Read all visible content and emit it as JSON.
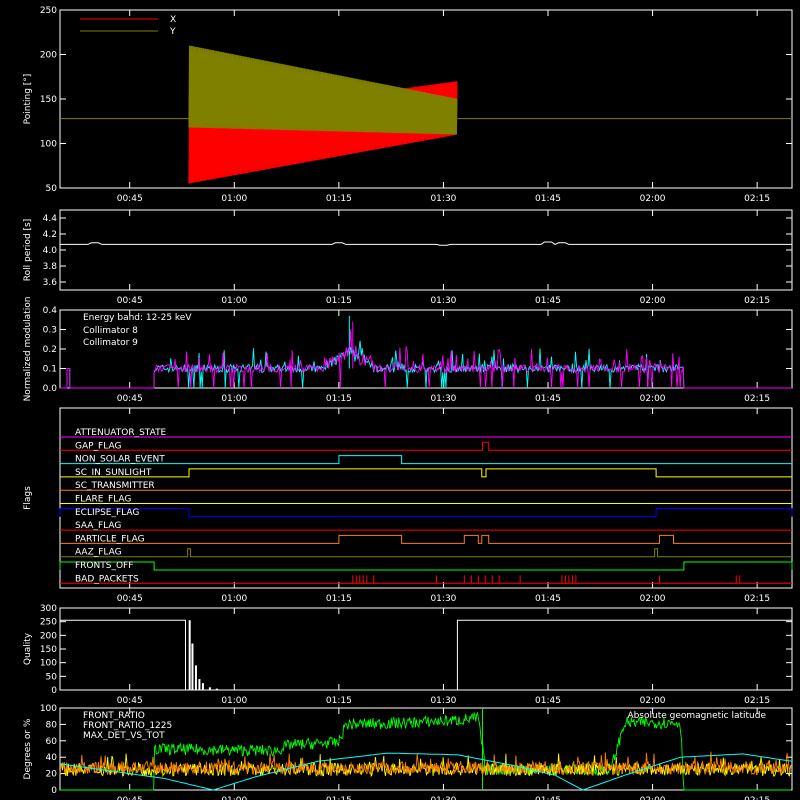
{
  "x_axis": {
    "ticks": [
      "00:45",
      "01:00",
      "01:15",
      "01:30",
      "01:45",
      "02:00",
      "02:15"
    ],
    "tick_minutes": [
      45,
      60,
      75,
      90,
      105,
      120,
      135
    ],
    "range_minutes": [
      35,
      140
    ]
  },
  "chart_data": [
    {
      "type": "line",
      "ylabel": "Pointing [°]",
      "ylim": [
        50,
        250
      ],
      "yticks": [
        "50",
        "100",
        "150",
        "200",
        "250"
      ],
      "ytick_values": [
        50,
        100,
        150,
        200,
        250
      ],
      "legend": [
        {
          "name": "X",
          "color": "#ff0000"
        },
        {
          "name": "Y",
          "color": "#808000"
        }
      ],
      "baseline": 128,
      "series": [
        {
          "name": "X",
          "color": "#ff0000",
          "segments": [
            {
              "t0": 35,
              "t1": 53.5,
              "value": 128
            },
            {
              "t0": 53.5,
              "t1": 92,
              "osc_low": [
                55,
                110
              ],
              "osc_high": [
                130,
                170
              ]
            },
            {
              "t0": 92,
              "t1": 140,
              "value": 128
            }
          ]
        },
        {
          "name": "Y",
          "color": "#808000",
          "segments": [
            {
              "t0": 53.5,
              "t1": 92,
              "osc_low": [
                118,
                110
              ],
              "osc_high": [
                210,
                150
              ]
            }
          ]
        }
      ]
    },
    {
      "type": "line",
      "ylabel": "Roll period [s]",
      "ylim": [
        3.5,
        4.5
      ],
      "yticks": [
        "3.6",
        "3.8",
        "4.0",
        "4.2",
        "4.4"
      ],
      "ytick_values": [
        3.6,
        3.8,
        4.0,
        4.2,
        4.4
      ],
      "series": [
        {
          "name": "",
          "color": "#ffffff",
          "value": 4.07,
          "bumps": [
            [
              40,
              4.09
            ],
            [
              75,
              4.09
            ],
            [
              90,
              4.06
            ],
            [
              105,
              4.1
            ],
            [
              107,
              4.09
            ]
          ]
        }
      ]
    },
    {
      "type": "line",
      "ylabel": "Normalized modulation",
      "ylim": [
        0,
        0.4
      ],
      "yticks": [
        "0.0",
        "0.1",
        "0.2",
        "0.3",
        "0.4"
      ],
      "ytick_values": [
        0,
        0.1,
        0.2,
        0.3,
        0.4
      ],
      "annotation": "Energy band: 12-25 keV",
      "legend": [
        {
          "name": "Collimator 8",
          "color": "#00ffff"
        },
        {
          "name": "Collimator 9",
          "color": "#ff00ff"
        }
      ],
      "active_range": [
        48.5,
        124.5
      ],
      "series": [
        {
          "name": "Collimator 8",
          "color": "#00ffff",
          "level": 0.1,
          "peak": 0.37
        },
        {
          "name": "Collimator 9",
          "color": "#ff00ff",
          "level": 0.1,
          "peak": 0.34
        }
      ]
    },
    {
      "type": "line",
      "ylabel": "Flags",
      "flags": [
        {
          "label": "ATTENUATOR_STATE",
          "color": "#ff00ff",
          "high": []
        },
        {
          "label": "GAP_FLAG",
          "color": "#ff0000",
          "high": [
            [
              95.6,
              96.5
            ]
          ]
        },
        {
          "label": "NON_SOLAR_EVENT",
          "color": "#00ffff",
          "high": [
            [
              75,
              84
            ]
          ]
        },
        {
          "label": "SC_IN_SUNLIGHT",
          "color": "#ffff00",
          "high": [
            [
              53.5,
              95.5
            ],
            [
              96.1,
              120.5
            ]
          ]
        },
        {
          "label": "SC_TRANSMITTER",
          "color": "#ff8000",
          "high": []
        },
        {
          "label": "FLARE_FLAG",
          "color": "#ffff00",
          "high": []
        },
        {
          "label": "ECLIPSE_FLAG",
          "color": "#0000ff",
          "high": [
            [
              35,
              53.5
            ],
            [
              120.5,
              140
            ]
          ]
        },
        {
          "label": "SAA_FLAG",
          "color": "#ff0000",
          "high": []
        },
        {
          "label": "PARTICLE_FLAG",
          "color": "#ff8000",
          "high": [
            [
              75,
              84
            ],
            [
              93,
              95
            ],
            [
              95.5,
              96.5
            ],
            [
              121,
              123
            ]
          ]
        },
        {
          "label": "AAZ_FLAG",
          "color": "#808000",
          "high": [
            [
              53.3,
              53.7
            ],
            [
              120.3,
              120.7
            ]
          ]
        },
        {
          "label": "FRONTS_OFF",
          "color": "#00ff00",
          "high": [
            [
              35,
              48.5
            ],
            [
              124.5,
              140
            ]
          ]
        },
        {
          "label": "BAD_PACKETS",
          "color": "#ff0000",
          "spikes": [
            77,
            77.5,
            78,
            78.5,
            79,
            80,
            89,
            93,
            94,
            95,
            96,
            97,
            98,
            101,
            107,
            107.5,
            108,
            108.5,
            109,
            121,
            132,
            132.5
          ]
        }
      ]
    },
    {
      "type": "line",
      "ylabel": "Quality",
      "ylim": [
        0,
        300
      ],
      "yticks": [
        "0",
        "50",
        "100",
        "150",
        "200",
        "250",
        "300"
      ],
      "ytick_values": [
        0,
        50,
        100,
        150,
        200,
        250,
        300
      ],
      "series": [
        {
          "name": "",
          "color": "#ffffff",
          "segments": [
            [
              35,
              53,
              255
            ],
            [
              53.5,
              92,
              0
            ],
            [
              92,
              140,
              255
            ]
          ],
          "spikes": [
            [
              53.6,
              255
            ],
            [
              54,
              170
            ],
            [
              54.5,
              90
            ],
            [
              55,
              40
            ],
            [
              55.5,
              25
            ],
            [
              56.5,
              10
            ],
            [
              57.5,
              5
            ]
          ]
        }
      ]
    },
    {
      "type": "line",
      "ylabel": "Degrees or %",
      "ylim": [
        0,
        100
      ],
      "yticks": [
        "0",
        "20",
        "40",
        "60",
        "80",
        "100"
      ],
      "ytick_values": [
        0,
        20,
        40,
        60,
        80,
        100
      ],
      "legend": [
        {
          "name": "FRONT_RATIO",
          "color": "#ffff00"
        },
        {
          "name": "FRONT_RATIO_1225",
          "color": "#00ff00"
        },
        {
          "name": "MAX_DET_VS_TOT",
          "color": "#ff8000"
        }
      ],
      "right_label": {
        "text": "Absolute geomagnetic latitude",
        "color": "#00ffff"
      },
      "series": [
        {
          "name": "FRONT_RATIO",
          "color": "#ffff00",
          "level": 25
        },
        {
          "name": "FRONT_RATIO_1225",
          "color": "#00ff00",
          "profile": [
            [
              35,
              0
            ],
            [
              48.5,
              0
            ],
            [
              48.5,
              50
            ],
            [
              66,
              48
            ],
            [
              68,
              55
            ],
            [
              75,
              58
            ],
            [
              76,
              80
            ],
            [
              85,
              82
            ],
            [
              92,
              85
            ],
            [
              95,
              88
            ],
            [
              96,
              25
            ],
            [
              114,
              25
            ],
            [
              116,
              82
            ],
            [
              124,
              82
            ],
            [
              124.5,
              0
            ],
            [
              140,
              0
            ]
          ]
        },
        {
          "name": "MAX_DET_VS_TOT",
          "color": "#ff8000",
          "level": 27
        },
        {
          "name": "Absolute geomagnetic latitude",
          "color": "#00ffff",
          "profile": [
            [
              35,
              32
            ],
            [
              50,
              14
            ],
            [
              57,
              0
            ],
            [
              63,
              16
            ],
            [
              72,
              35
            ],
            [
              82,
              45
            ],
            [
              92,
              43
            ],
            [
              100,
              30
            ],
            [
              106,
              18
            ],
            [
              110,
              0
            ],
            [
              116,
              18
            ],
            [
              124,
              40
            ],
            [
              133,
              44
            ],
            [
              140,
              35
            ]
          ]
        }
      ]
    }
  ]
}
